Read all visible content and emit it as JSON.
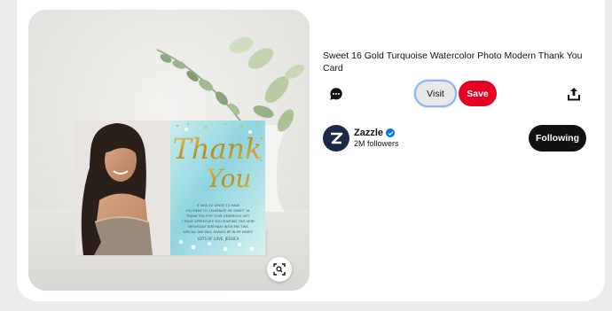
{
  "pin": {
    "title": "Sweet 16 Gold Turquoise Watercolor Photo Modern Thank You Card",
    "image_icon": "visual-search-icon"
  },
  "card_text": {
    "heading_line1": "Thank",
    "heading_line2": "You",
    "lines": [
      "IT WAS SO GREAT TO HAVE",
      "YOU HERE TO CELEBRATE MY SWEET 16.",
      "THANK YOU FOR YOUR GENEROUS GIFT.",
      "I TRULY APPRECIATE YOU SHARING THIS VERY",
      "IMPORTANT BIRTHDAY WITH ME! THIS",
      "SPECIAL DAY WILL ALWAYS BE IN MY HEART."
    ],
    "signoff": "LOTS OF LOVE, JESSICA"
  },
  "actions": {
    "comment_icon": "comment-icon",
    "visit_label": "Visit",
    "save_label": "Save",
    "share_icon": "share-icon"
  },
  "creator": {
    "name": "Zazzle",
    "followers": "2M followers",
    "follow_label": "Following",
    "verified_icon": "verified-icon"
  },
  "colors": {
    "save": "#e60023",
    "following": "#111111",
    "verified": "#0074e8",
    "gold": "#c9a227",
    "turquoise": "#8ed3dc"
  }
}
